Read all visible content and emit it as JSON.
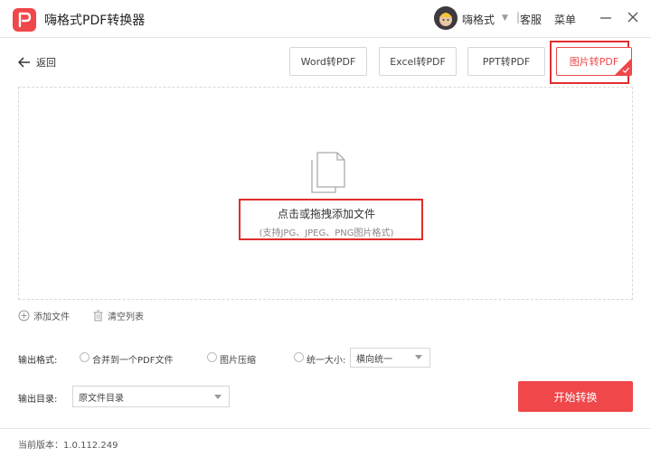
{
  "titlebar": {
    "app_title": "嗨格式PDF转换器",
    "username": "嗨格式",
    "separator": "|",
    "support": "客服",
    "menu": "菜单"
  },
  "toolbar": {
    "back_label": "返回",
    "tabs": [
      {
        "label": "Word转PDF"
      },
      {
        "label": "Excel转PDF"
      },
      {
        "label": "PPT转PDF"
      },
      {
        "label": "图片转PDF"
      }
    ],
    "active_tab": "图片转PDF"
  },
  "dropzone": {
    "title": "点击或拖拽添加文件",
    "hint": "(支持JPG、JPEG、PNG图片格式)"
  },
  "actions": {
    "add_file": "添加文件",
    "clear_list": "清空列表"
  },
  "output": {
    "format_label": "输出格式:",
    "options": [
      {
        "label": "合并到一个PDF文件"
      },
      {
        "label": "图片压缩"
      },
      {
        "label": "统一大小:"
      }
    ],
    "size_select_value": "横向统一",
    "dir_label": "输出目录:",
    "dir_select_value": "原文件目录"
  },
  "start_button": "开始转换",
  "footer": {
    "version": "当前版本：1.0.112.249"
  },
  "colors": {
    "accent": "#f0474a",
    "highlight_border": "#e02d2d"
  }
}
